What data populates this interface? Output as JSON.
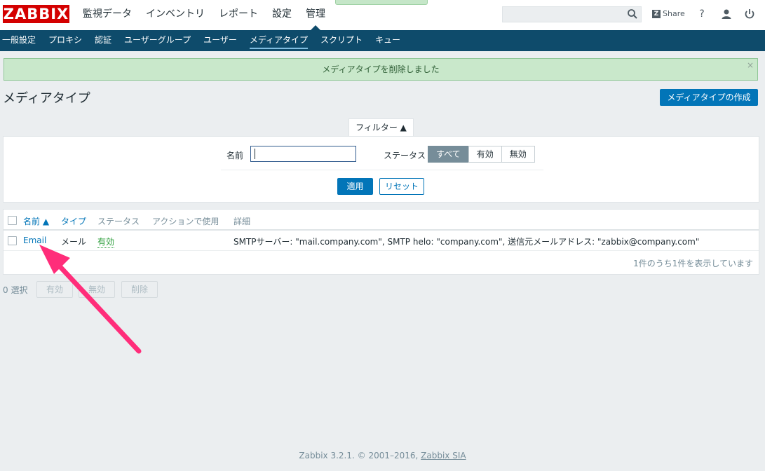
{
  "header": {
    "logo": "ZABBIX",
    "menu": [
      "監視データ",
      "インベントリ",
      "レポート",
      "設定",
      "管理"
    ],
    "share_label": "Share",
    "share_badge": "Z",
    "help_glyph": "?"
  },
  "submenu": [
    "一般設定",
    "プロキシ",
    "認証",
    "ユーザーグループ",
    "ユーザー",
    "メディアタイプ",
    "スクリプト",
    "キュー"
  ],
  "message": {
    "text": "メディアタイプを削除しました",
    "close": "×"
  },
  "page": {
    "title": "メディアタイプ",
    "create_button": "メディアタイプの作成"
  },
  "filter": {
    "tab_label": "フィルター ▲",
    "name_label": "名前",
    "name_value": "",
    "status_label": "ステータス",
    "status_options": [
      "すべて",
      "有効",
      "無効"
    ],
    "status_selected": "すべて",
    "apply": "適用",
    "reset": "リセット"
  },
  "table": {
    "headers": {
      "name": "名前 ▲",
      "type": "タイプ",
      "status": "ステータス",
      "used_in_actions": "アクションで使用",
      "details": "詳細"
    },
    "rows": [
      {
        "name": "Email",
        "type": "メール",
        "status": "有効",
        "used_in_actions": "",
        "details": "SMTPサーバー: \"mail.company.com\", SMTP helo: \"company.com\", 送信元メールアドレス: \"zabbix@company.com\""
      }
    ],
    "summary": "1件のうち1件を表示しています"
  },
  "actions": {
    "selected": "0 選択",
    "enable": "有効",
    "disable": "無効",
    "delete": "削除"
  },
  "footer": {
    "text": "Zabbix 3.2.1. © 2001–2016, ",
    "company": "Zabbix SIA"
  },
  "colors": {
    "brand": "#d40000",
    "nav": "#0e4b6b",
    "accent": "#0275b8",
    "success": "#2b9d3a",
    "annotation_arrow": "#ff2d7a"
  }
}
